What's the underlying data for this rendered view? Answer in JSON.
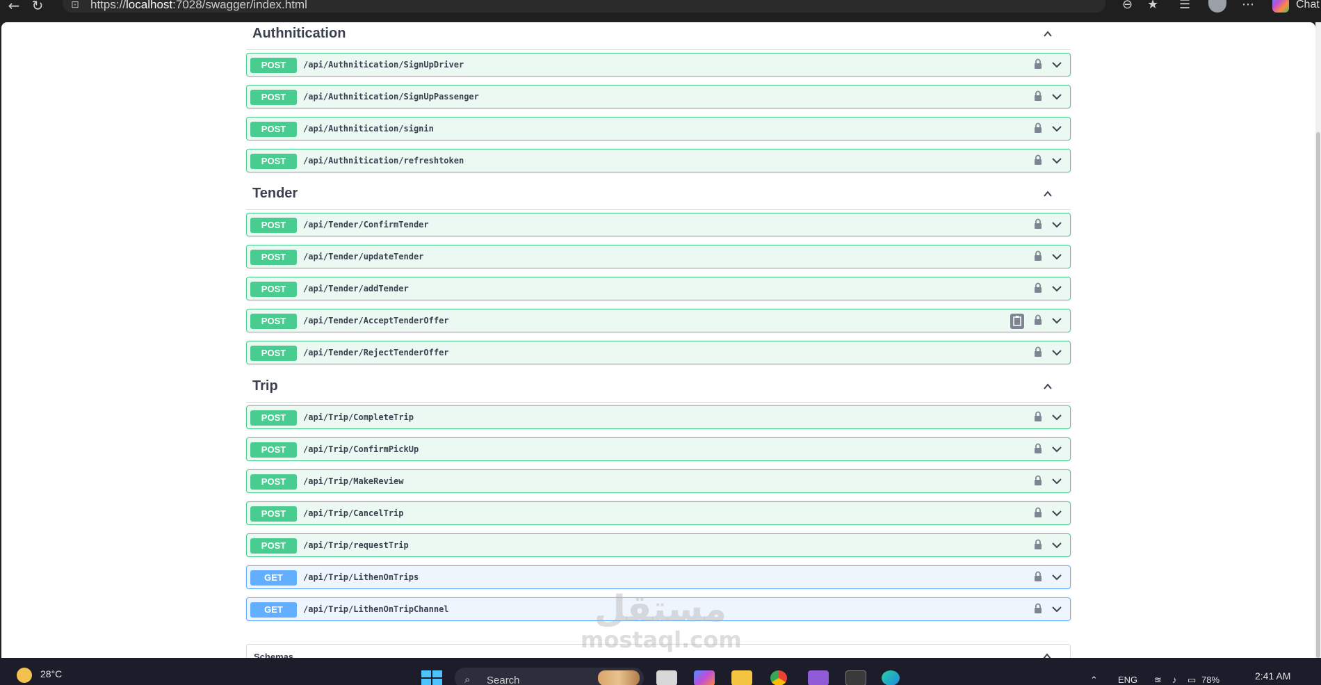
{
  "browser": {
    "url_prefix": "https://",
    "url_host": "localhost",
    "url_rest": ":7028/swagger/index.html",
    "chat_label": "Chat"
  },
  "sections": [
    {
      "title": "Authnitication",
      "operations": [
        {
          "method": "POST",
          "path": "/api/Authnitication/SignUpDriver"
        },
        {
          "method": "POST",
          "path": "/api/Authnitication/SignUpPassenger"
        },
        {
          "method": "POST",
          "path": "/api/Authnitication/signin"
        },
        {
          "method": "POST",
          "path": "/api/Authnitication/refreshtoken"
        }
      ]
    },
    {
      "title": "Tender",
      "operations": [
        {
          "method": "POST",
          "path": "/api/Tender/ConfirmTender"
        },
        {
          "method": "POST",
          "path": "/api/Tender/updateTender"
        },
        {
          "method": "POST",
          "path": "/api/Tender/addTender"
        },
        {
          "method": "POST",
          "path": "/api/Tender/AcceptTenderOffer",
          "copy": true
        },
        {
          "method": "POST",
          "path": "/api/Tender/RejectTenderOffer"
        }
      ]
    },
    {
      "title": "Trip",
      "operations": [
        {
          "method": "POST",
          "path": "/api/Trip/CompleteTrip"
        },
        {
          "method": "POST",
          "path": "/api/Trip/ConfirmPickUp"
        },
        {
          "method": "POST",
          "path": "/api/Trip/MakeReview"
        },
        {
          "method": "POST",
          "path": "/api/Trip/CancelTrip"
        },
        {
          "method": "POST",
          "path": "/api/Trip/requestTrip"
        },
        {
          "method": "GET",
          "path": "/api/Trip/LithenOnTrips"
        },
        {
          "method": "GET",
          "path": "/api/Trip/LithenOnTripChannel"
        }
      ]
    }
  ],
  "schemas_label": "Schemas",
  "watermark": {
    "arabic": "مستقل",
    "latin": "mostaql.com"
  },
  "taskbar": {
    "temperature": "28°C",
    "search_placeholder": "Search",
    "language": "ENG",
    "battery": "78%",
    "time": "2:41 AM"
  },
  "colors": {
    "post": "#49cc90",
    "get": "#61affe"
  }
}
